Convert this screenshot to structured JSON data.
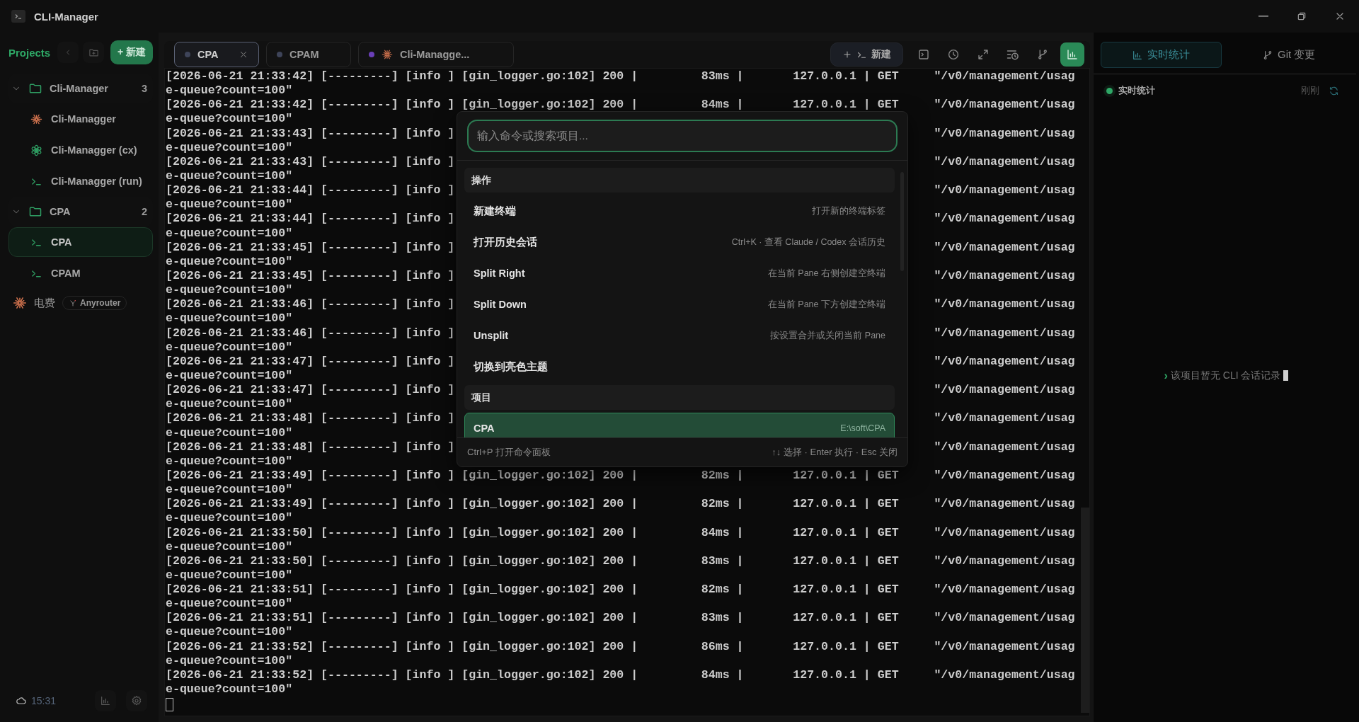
{
  "window": {
    "title": "CLI-Manager"
  },
  "sidebar": {
    "title": "Projects",
    "new_button": "+ 新建",
    "groups": [
      {
        "name": "Cli-Manager",
        "count": "3",
        "expanded": true,
        "children": [
          {
            "kind": "claude",
            "label": "Cli-Managger",
            "selected": false
          },
          {
            "kind": "openai",
            "label": "Cli-Managger (cx)",
            "selected": false
          },
          {
            "kind": "terminal",
            "label": "Cli-Managger (run)",
            "selected": false
          }
        ]
      },
      {
        "name": "CPA",
        "count": "2",
        "expanded": true,
        "children": [
          {
            "kind": "terminal",
            "label": "CPA",
            "selected": true
          },
          {
            "kind": "terminal",
            "label": "CPAM",
            "selected": false
          }
        ]
      }
    ],
    "loose_items": [
      {
        "kind": "claude",
        "label": "电费",
        "tag": "Anyrouter"
      }
    ],
    "status": {
      "time": "15:31"
    }
  },
  "tabs": [
    {
      "label": "CPA",
      "selected": true,
      "closable": true,
      "color": "#3e4459",
      "kind": "plain"
    },
    {
      "label": "CPAM",
      "selected": false,
      "closable": false,
      "color": "#3e4459",
      "kind": "plain"
    },
    {
      "label": "Cli-Managge...",
      "selected": false,
      "closable": false,
      "color": "#6a3fb8",
      "kind": "claude"
    }
  ],
  "toolbar": {
    "new_label": "新建",
    "buttons": [
      {
        "kind": "terminal",
        "active": false
      },
      {
        "kind": "clock",
        "active": false
      },
      {
        "kind": "expand",
        "active": false
      },
      {
        "kind": "history",
        "active": false
      },
      {
        "kind": "git",
        "active": false
      },
      {
        "kind": "chart",
        "active": true
      }
    ]
  },
  "terminal": {
    "rows": [
      {
        "kind": "full",
        "line": "[2026-06-21 21:33:42] [---------] [info ] [gin_logger.go:102] 200 |         83ms |       127.0.0.1 | GET     \"/v0/management/usag",
        "wrap": "e-queue?count=100\""
      },
      {
        "kind": "full",
        "line": "[2026-06-21 21:33:42] [---------] [info ] [gin_logger.go:102] 200 |         84ms |       127.0.0.1 | GET     \"/v0/management/usag",
        "wrap": "e-queue?count=100\""
      },
      {
        "kind": "covered",
        "left": "[2026-06-21 21:33:43] [---------] [info ]",
        "right": "\"/v0/management/usag",
        "wrap": "e-queue?count=100\""
      },
      {
        "kind": "covered",
        "left": "[2026-06-21 21:33:43] [---------] [info ]",
        "right": "\"/v0/management/usag",
        "wrap": "e-queue?count=100\""
      },
      {
        "kind": "covered",
        "left": "[2026-06-21 21:33:44] [---------] [info ]",
        "right": "\"/v0/management/usag",
        "wrap": "e-queue?count=100\""
      },
      {
        "kind": "covered",
        "left": "[2026-06-21 21:33:44] [---------] [info ]",
        "right": "\"/v0/management/usag",
        "wrap": "e-queue?count=100\""
      },
      {
        "kind": "covered",
        "left": "[2026-06-21 21:33:45] [---------] [info ]",
        "right": "\"/v0/management/usag",
        "wrap": "e-queue?count=100\""
      },
      {
        "kind": "covered",
        "left": "[2026-06-21 21:33:45] [---------] [info ]",
        "right": "\"/v0/management/usag",
        "wrap": "e-queue?count=100\""
      },
      {
        "kind": "covered",
        "left": "[2026-06-21 21:33:46] [---------] [info ]",
        "right": "\"/v0/management/usag",
        "wrap": "e-queue?count=100\""
      },
      {
        "kind": "covered",
        "left": "[2026-06-21 21:33:46] [---------] [info ]",
        "right": "\"/v0/management/usag",
        "wrap": "e-queue?count=100\""
      },
      {
        "kind": "covered",
        "left": "[2026-06-21 21:33:47] [---------] [info ]",
        "right": "\"/v0/management/usag",
        "wrap": "e-queue?count=100\""
      },
      {
        "kind": "covered",
        "left": "[2026-06-21 21:33:47] [---------] [info ]",
        "right": "\"/v0/management/usag",
        "wrap": "e-queue?count=100\""
      },
      {
        "kind": "covered",
        "left": "[2026-06-21 21:33:48] [---------] [info ]",
        "right": "\"/v0/management/usag",
        "wrap": "e-queue?count=100\""
      },
      {
        "kind": "covered",
        "left": "[2026-06-21 21:33:48] [---------] [info ]",
        "right": "\"/v0/management/usag",
        "wrap": "e-queue?count=100\""
      },
      {
        "kind": "full",
        "line": "[2026-06-21 21:33:49] [---------] [info ] [gin_logger.go:102] 200 |         82ms |       127.0.0.1 | GET     \"/v0/management/usag",
        "wrap": "e-queue?count=100\""
      },
      {
        "kind": "full",
        "line": "[2026-06-21 21:33:49] [---------] [info ] [gin_logger.go:102] 200 |         82ms |       127.0.0.1 | GET     \"/v0/management/usag",
        "wrap": "e-queue?count=100\""
      },
      {
        "kind": "full",
        "line": "[2026-06-21 21:33:50] [---------] [info ] [gin_logger.go:102] 200 |         84ms |       127.0.0.1 | GET     \"/v0/management/usag",
        "wrap": "e-queue?count=100\""
      },
      {
        "kind": "full",
        "line": "[2026-06-21 21:33:50] [---------] [info ] [gin_logger.go:102] 200 |         83ms |       127.0.0.1 | GET     \"/v0/management/usag",
        "wrap": "e-queue?count=100\""
      },
      {
        "kind": "full",
        "line": "[2026-06-21 21:33:51] [---------] [info ] [gin_logger.go:102] 200 |         82ms |       127.0.0.1 | GET     \"/v0/management/usag",
        "wrap": "e-queue?count=100\""
      },
      {
        "kind": "full",
        "line": "[2026-06-21 21:33:51] [---------] [info ] [gin_logger.go:102] 200 |         83ms |       127.0.0.1 | GET     \"/v0/management/usag",
        "wrap": "e-queue?count=100\""
      },
      {
        "kind": "full",
        "line": "[2026-06-21 21:33:52] [---------] [info ] [gin_logger.go:102] 200 |         86ms |       127.0.0.1 | GET     \"/v0/management/usag",
        "wrap": "e-queue?count=100\""
      },
      {
        "kind": "full",
        "line": "[2026-06-21 21:33:52] [---------] [info ] [gin_logger.go:102] 200 |         84ms |       127.0.0.1 | GET     \"/v0/management/usag",
        "wrap": "e-queue?count=100\""
      }
    ]
  },
  "command_palette": {
    "placeholder": "输入命令或搜索项目...",
    "sections": [
      {
        "title": "操作",
        "items": [
          {
            "label": "新建终端",
            "hint": "打开新的终端标签",
            "selected": false
          },
          {
            "label": "打开历史会话",
            "hint": "Ctrl+K · 查看 Claude / Codex 会话历史",
            "selected": false
          },
          {
            "label": "Split Right",
            "hint": "在当前 Pane 右侧创建空终端",
            "selected": false
          },
          {
            "label": "Split Down",
            "hint": "在当前 Pane 下方创建空终端",
            "selected": false
          },
          {
            "label": "Unsplit",
            "hint": "按设置合并或关闭当前 Pane",
            "selected": false
          },
          {
            "label": "切换到亮色主题",
            "selected": false
          }
        ]
      },
      {
        "title": "项目",
        "items": [
          {
            "label": "CPA",
            "hint": "E:\\soft\\CPA",
            "selected": true
          }
        ]
      }
    ],
    "footer": {
      "left": "Ctrl+P 打开命令面板",
      "right": "↑↓ 选择 · Enter 执行 · Esc 关闭"
    }
  },
  "right_panel": {
    "tabs": [
      {
        "label": "实时统计",
        "selected": true,
        "kind": "chart"
      },
      {
        "label": "Git 变更",
        "selected": false,
        "kind": "git"
      }
    ],
    "header": {
      "title": "实时统计",
      "updated": "刚刚",
      "live": true
    },
    "empty": {
      "prompt": "›",
      "message": "该项目暂无 CLI 会话记录"
    }
  }
}
